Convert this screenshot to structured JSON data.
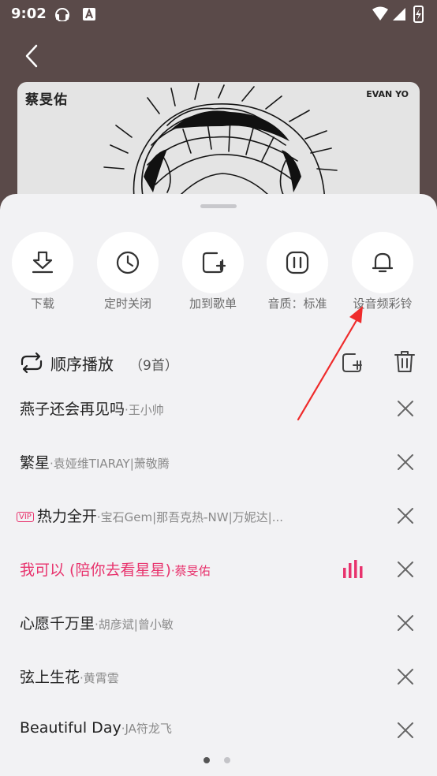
{
  "status_bar": {
    "time": "9:02"
  },
  "album": {
    "artist_text": "蔡旻佑",
    "brand_text": "EVAN YO"
  },
  "actions": [
    {
      "label": "下载",
      "icon": "download-icon"
    },
    {
      "label": "定时关闭",
      "icon": "clock-icon"
    },
    {
      "label": "加到歌单",
      "icon": "add-to-playlist-icon"
    },
    {
      "label": "音质：标准",
      "icon": "audio-quality-icon"
    },
    {
      "label": "设音频彩铃",
      "icon": "bell-icon"
    }
  ],
  "playlist": {
    "mode_label": "顺序播放",
    "count_label": "（9首）",
    "songs": [
      {
        "title": "燕子还会再见吗",
        "artist": "·王小帅",
        "vip": "",
        "playing": false
      },
      {
        "title": "繁星",
        "artist": "·袁娅维TIARAY|萧敬腾",
        "vip": "",
        "playing": false
      },
      {
        "title": "热力全开",
        "artist": "·宝石Gem|那吾克热-NW|万妮达|...",
        "vip": "VIP",
        "playing": false
      },
      {
        "title": "我可以 (陪你去看星星)",
        "artist": "·蔡旻佑",
        "vip": "",
        "playing": true
      },
      {
        "title": "心愿千万里",
        "artist": "·胡彦斌|曾小敏",
        "vip": "",
        "playing": false
      },
      {
        "title": "弦上生花",
        "artist": "·黄霄雲",
        "vip": "",
        "playing": false
      },
      {
        "title": "Beautiful Day",
        "artist": "·JA符龙飞",
        "vip": "",
        "playing": false
      }
    ]
  },
  "colors": {
    "accent": "#e8336d",
    "sheet_bg": "#f2f2f4",
    "backdrop": "#5a4a49"
  }
}
